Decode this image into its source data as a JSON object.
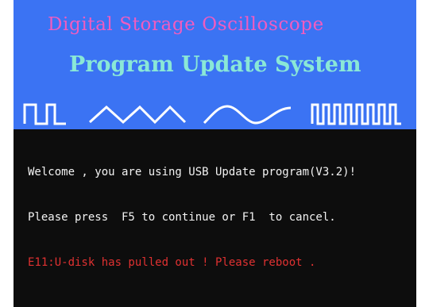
{
  "colors": {
    "header_background": "#3b73f3",
    "screen_background": "#0d0d0d",
    "title_line_1": "#f05cc0",
    "title_line_2": "#8ae8d6",
    "waveform": "#ffffff",
    "console_text": "#f2f2f2",
    "error_text": "#e03131"
  },
  "header": {
    "title_line_1": "Digital Storage Oscilloscope",
    "title_line_2": "Program Update System",
    "waveform_icons": [
      "square-wave-icon",
      "triangle-wave-icon",
      "sine-wave-icon",
      "pulse-train-icon"
    ]
  },
  "console": {
    "welcome_line": "Welcome , you are using USB Update program(V3.2)!",
    "prompt_line": "Please press  F5 to continue or F1  to cancel.",
    "error_line": "E11:U-disk has pulled out ! Please reboot ."
  }
}
